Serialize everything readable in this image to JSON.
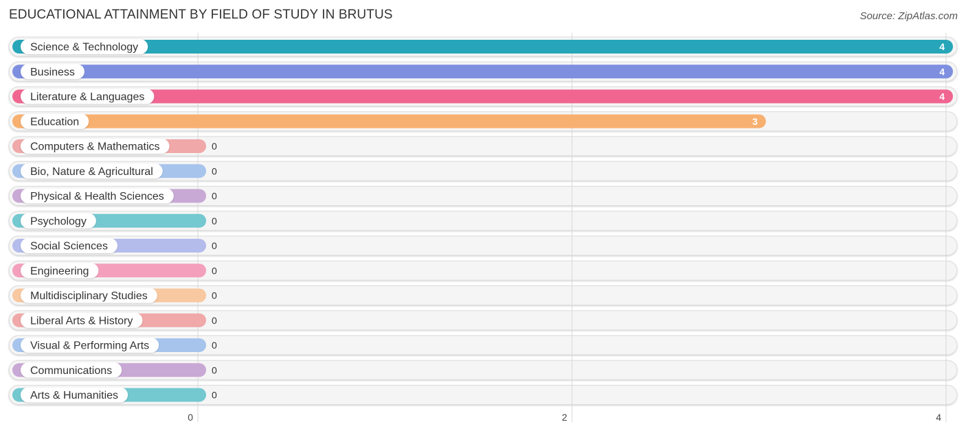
{
  "header": {
    "title": "EDUCATIONAL ATTAINMENT BY FIELD OF STUDY IN BRUTUS",
    "source": "Source: ZipAtlas.com"
  },
  "chart_data": {
    "type": "bar",
    "orientation": "horizontal",
    "title": "EDUCATIONAL ATTAINMENT BY FIELD OF STUDY IN BRUTUS",
    "xlabel": "",
    "ylabel": "",
    "xlim": [
      0,
      4
    ],
    "x_ticks": [
      0,
      2,
      4
    ],
    "grid": true,
    "categories": [
      "Science & Technology",
      "Business",
      "Literature & Languages",
      "Education",
      "Computers & Mathematics",
      "Bio, Nature & Agricultural",
      "Physical & Health Sciences",
      "Psychology",
      "Social Sciences",
      "Engineering",
      "Multidisciplinary Studies",
      "Liberal Arts & History",
      "Visual & Performing Arts",
      "Communications",
      "Arts & Humanities"
    ],
    "values": [
      4,
      4,
      4,
      3,
      0,
      0,
      0,
      0,
      0,
      0,
      0,
      0,
      0,
      0,
      0
    ],
    "value_labels": [
      "4",
      "4",
      "4",
      "3",
      "0",
      "0",
      "0",
      "0",
      "0",
      "0",
      "0",
      "0",
      "0",
      "0",
      "0"
    ],
    "colors": [
      "#26a6b8",
      "#7e8fe0",
      "#f06690",
      "#f8b070",
      "#f0a8a8",
      "#a6c4ec",
      "#c8a8d4",
      "#74c8d0",
      "#b4bcec",
      "#f4a0bc",
      "#f8c8a0",
      "#f0a8a8",
      "#a6c4ec",
      "#c8a8d4",
      "#74c8d0"
    ]
  }
}
